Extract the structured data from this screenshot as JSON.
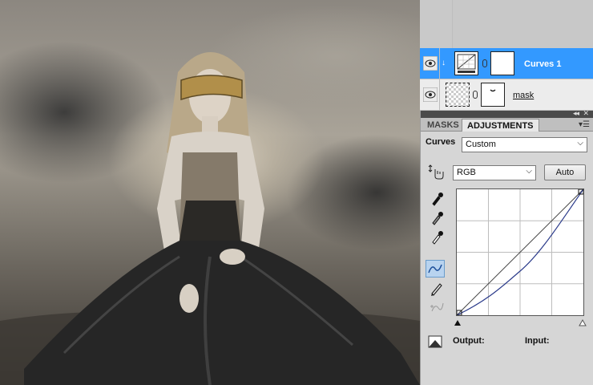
{
  "layers": [
    {
      "name": "Curves 1",
      "selected": true,
      "thumbnail_icon": "curves-adjustment-icon"
    },
    {
      "name": "mask",
      "selected": false,
      "thumbnail_icon": "transparent-layer-icon"
    }
  ],
  "panel": {
    "tabs": [
      "MASKS",
      "ADJUSTMENTS"
    ],
    "active_tab": "ADJUSTMENTS",
    "adjustment_label": "Curves",
    "preset_value": "Custom",
    "channel_value": "RGB",
    "auto_label": "Auto",
    "output_label": "Output:",
    "input_label": "Input:"
  },
  "tools": [
    "on-image-adjust-icon",
    "black-point-eyedropper-icon",
    "gray-point-eyedropper-icon",
    "white-point-eyedropper-icon",
    "curve-edit-points-icon",
    "pencil-draw-icon",
    "smooth-curve-icon"
  ],
  "colors": {
    "selection": "#3399ff",
    "panel_bg": "#d6d6d6",
    "header_dark": "#4a4a4a"
  }
}
